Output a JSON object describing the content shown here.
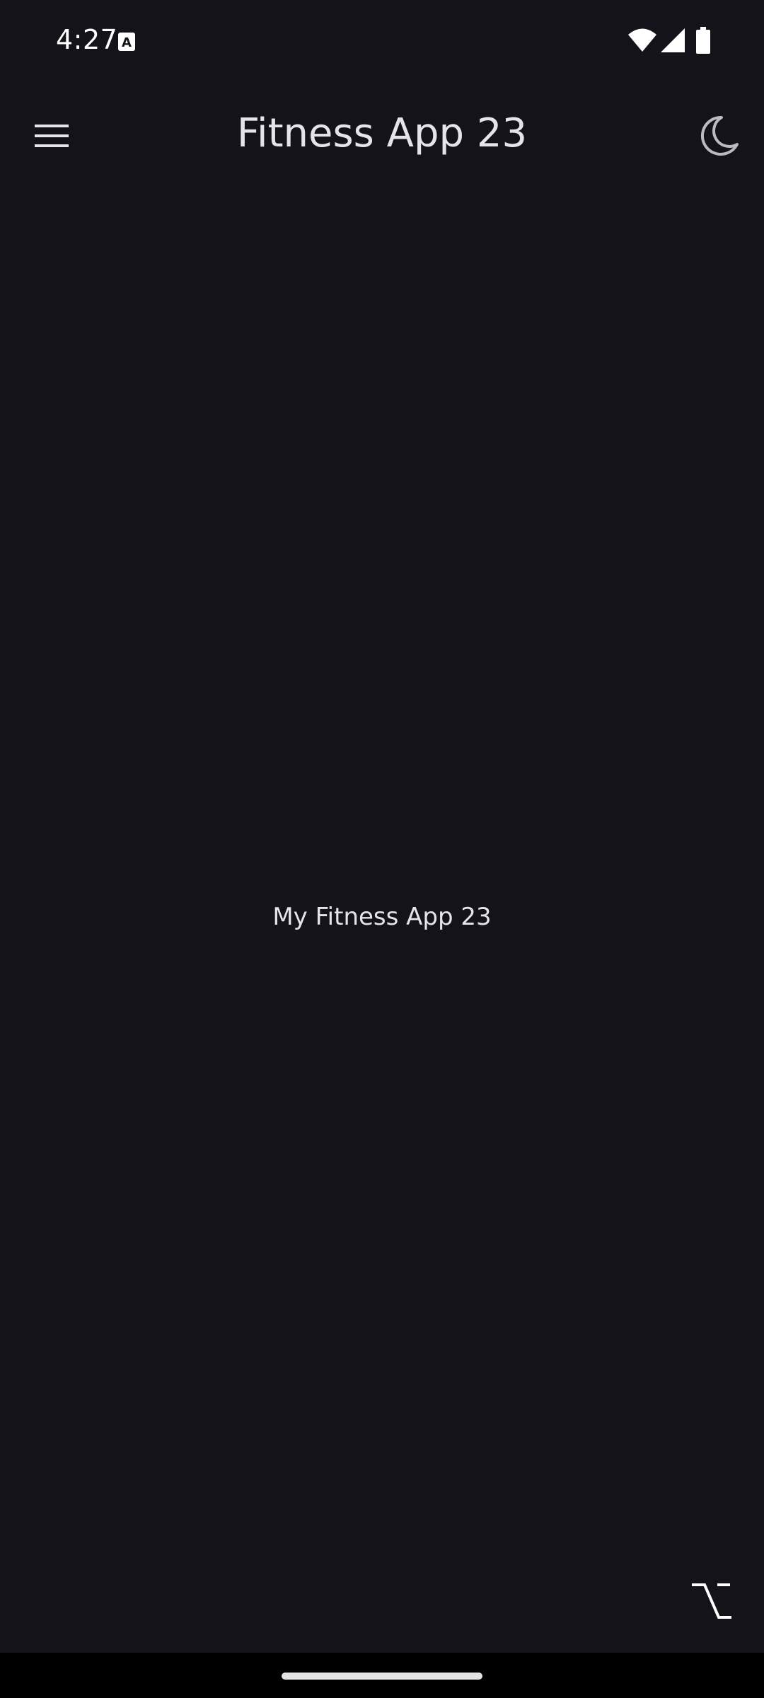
{
  "status_bar": {
    "time": "4:27",
    "icons": [
      "keyboard-a-icon",
      "wifi-icon",
      "cell-signal-icon",
      "battery-icon"
    ]
  },
  "top_bar": {
    "title": "Fitness App 23",
    "menu_icon": "hamburger-menu-icon",
    "theme_icon": "moon-icon"
  },
  "main": {
    "text": "My Fitness App 23"
  },
  "corner_action": {
    "icon": "option-key-icon"
  },
  "colors": {
    "background": "#15131a",
    "text": "#e6e3ea",
    "nav_bar": "#000000"
  }
}
